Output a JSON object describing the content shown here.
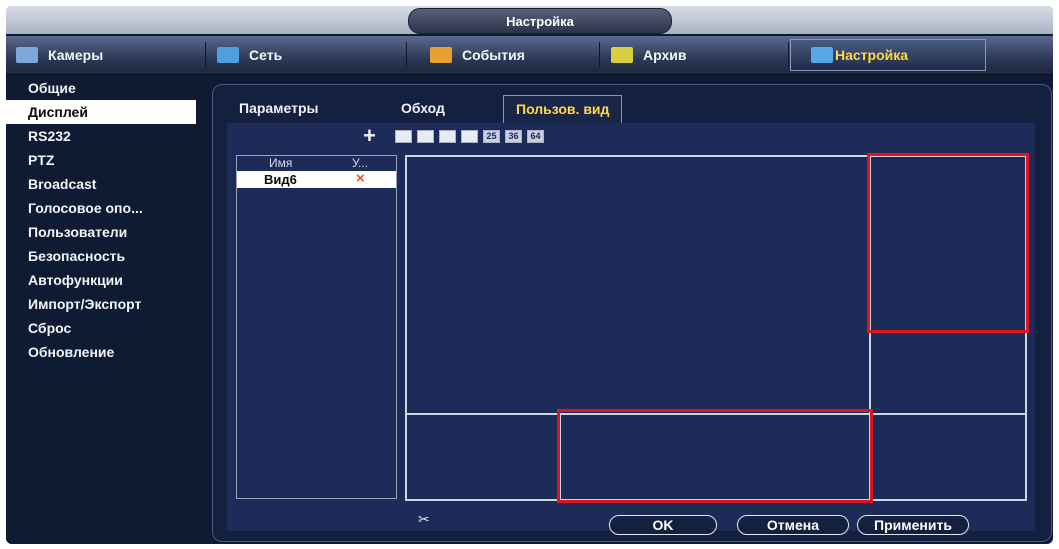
{
  "window": {
    "title": "Настройка"
  },
  "topnav": [
    {
      "label": "Камеры",
      "icon": "camera-icon",
      "color": "#7fa8d8"
    },
    {
      "label": "Сеть",
      "icon": "network-icon",
      "color": "#4fa0e0"
    },
    {
      "label": "События",
      "icon": "events-icon",
      "color": "#e8a030"
    },
    {
      "label": "Архив",
      "icon": "archive-icon",
      "color": "#d8d040"
    },
    {
      "label": "Настройка",
      "icon": "settings-icon",
      "color": "#58a8e8",
      "active": true
    }
  ],
  "sidebar": {
    "items": [
      {
        "label": "Общие"
      },
      {
        "label": "Дисплей",
        "active": true
      },
      {
        "label": "RS232"
      },
      {
        "label": "PTZ"
      },
      {
        "label": "Broadcast"
      },
      {
        "label": "Голосовое опо..."
      },
      {
        "label": "Пользователи"
      },
      {
        "label": "Безопасность"
      },
      {
        "label": "Автофункции"
      },
      {
        "label": "Импорт/Экспорт"
      },
      {
        "label": "Сброс"
      },
      {
        "label": "Обновление"
      }
    ]
  },
  "subtabs": [
    {
      "label": "Параметры"
    },
    {
      "label": "Обход"
    },
    {
      "label": "Пользов. вид",
      "active": true
    }
  ],
  "toolbar": {
    "add_label": "+",
    "layouts": [
      "1x4",
      "1+5",
      "3x3",
      "4x4",
      "25",
      "36",
      "64"
    ],
    "layout_numbers": [
      "25",
      "36",
      "64"
    ]
  },
  "list": {
    "columns": [
      "Имя",
      "У..."
    ],
    "rows": [
      {
        "name": "Вид6",
        "delete": "×"
      }
    ]
  },
  "buttons": {
    "ok": "OK",
    "cancel": "Отмена",
    "apply": "Применить"
  },
  "colors": {
    "accent_text": "#ffd94a",
    "highlight_box": "#e0141e",
    "panel_bg": "#1d2b58"
  }
}
